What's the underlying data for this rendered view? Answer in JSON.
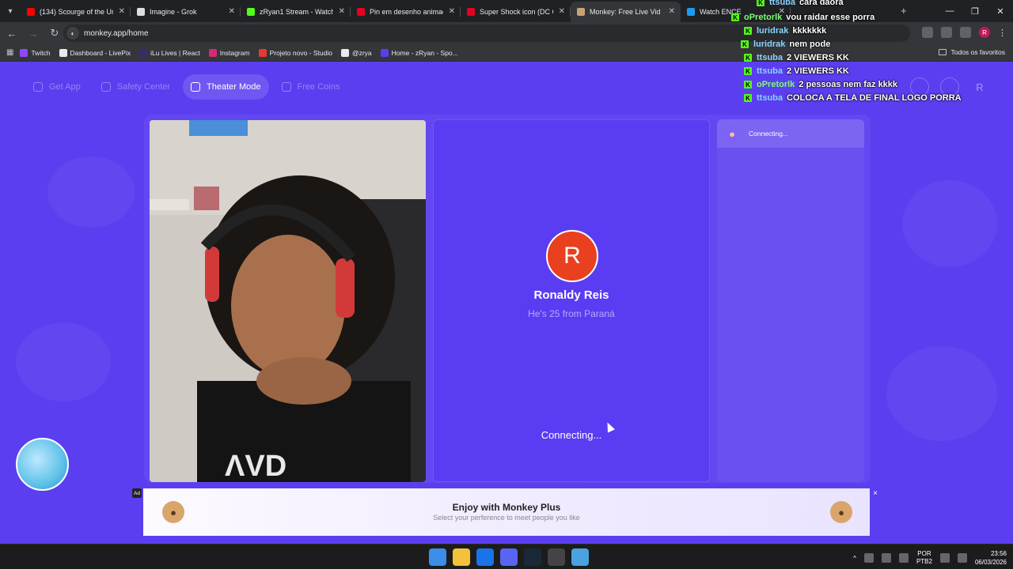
{
  "browser": {
    "tabs": [
      {
        "title": "(134) Scourge of the Unive",
        "favicon_color": "#ff0000",
        "active": false
      },
      {
        "title": "Imagine - Grok",
        "favicon_color": "#dddddd",
        "active": false
      },
      {
        "title": "zRyan1 Stream - Watch Li",
        "favicon_color": "#53fc18",
        "active": false
      },
      {
        "title": "Pin em desenho animado",
        "favicon_color": "#e60023",
        "active": false
      },
      {
        "title": "Super Shock icon (DC Co",
        "favicon_color": "#e60023",
        "active": false
      },
      {
        "title": "Monkey: Free Live Vid",
        "favicon_color": "#c9a27a",
        "active": true
      },
      {
        "title": "Watch ENCE",
        "favicon_color": "#1d9bf0",
        "active": false
      }
    ],
    "url": "monkey.app/home",
    "profile_initial": "R",
    "bookmarks": [
      {
        "label": "Twitch",
        "icon_color": "#9146ff"
      },
      {
        "label": "Dashboard - LivePix",
        "icon_color": "#e8eaed"
      },
      {
        "label": "iLu Lives | React",
        "icon_color": "#3a2b6e"
      },
      {
        "label": "Instagram",
        "icon_color": "#d62976"
      },
      {
        "label": "Projeto novo - Studio",
        "icon_color": "#e53935"
      },
      {
        "label": "@zrya",
        "icon_color": "#e8eaed"
      },
      {
        "label": "Home - zRyan - Spo...",
        "icon_color": "#5b3ef0"
      }
    ],
    "all_bookmarks": "Todos os favoritos"
  },
  "app": {
    "nav": [
      {
        "label": "Get App",
        "active": false,
        "icon": "phone-icon"
      },
      {
        "label": "Safety Center",
        "active": false,
        "icon": "shield-icon"
      },
      {
        "label": "Theater Mode",
        "active": true,
        "icon": "expand-icon"
      },
      {
        "label": "Free Coins",
        "active": false,
        "icon": "coins-icon"
      }
    ],
    "profile_initial": "R",
    "remote_user": {
      "initial": "R",
      "name": "Ronaldy Reis",
      "subtitle": "He's 25 from Paraná",
      "status": "Connecting..."
    },
    "chat_header": "Connecting...",
    "ad": {
      "tag": "Ad",
      "title": "Enjoy with Monkey Plus",
      "subtitle": "Select your perference to meet people you like",
      "close": "×"
    }
  },
  "chat_overlay": [
    {
      "user": "ttsuba",
      "user_color": "#8ad1ff",
      "message": "cara daora"
    },
    {
      "user": "oPretorlk",
      "user_color": "#7cff6b",
      "message": "vou raidar esse porra"
    },
    {
      "user": "luridrak",
      "user_color": "#8ad1ff",
      "message": "kkkkkkk"
    },
    {
      "user": "luridrak",
      "user_color": "#8ad1ff",
      "message": "nem pode"
    },
    {
      "user": "ttsuba",
      "user_color": "#8ad1ff",
      "message": "2 VIEWERS KK"
    },
    {
      "user": "ttsuba",
      "user_color": "#8ad1ff",
      "message": "2 VIEWERS KK"
    },
    {
      "user": "oPretorlk",
      "user_color": "#7cff6b",
      "message": "2 pessoas nem faz kkkk"
    },
    {
      "user": "ttsuba",
      "user_color": "#8ad1ff",
      "message": "COLOCA A TELA DE FINAL LOGO PORRA"
    }
  ],
  "taskbar": {
    "apps": [
      "windows-start-icon",
      "file-explorer-icon",
      "chrome-icon",
      "discord-icon",
      "steam-icon",
      "obs-icon",
      "notepad-icon"
    ],
    "language": "POR",
    "layout": "PTB2",
    "time": "23:56",
    "date": "06/03/2026"
  },
  "theme": {
    "accent": "#5b3ef0",
    "avatar_color": "#e9401f",
    "kick_green": "#53fc18"
  }
}
